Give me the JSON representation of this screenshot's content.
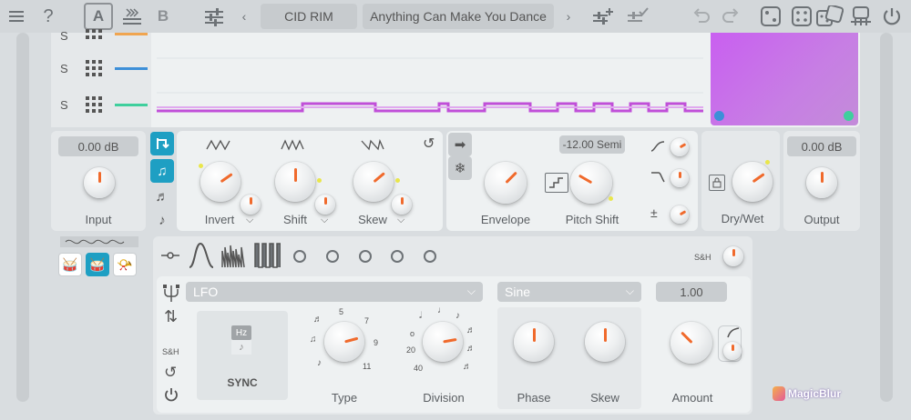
{
  "topbar": {
    "menu_icon": "hamburger-icon",
    "help_icon": "question-icon",
    "slot_a": "A",
    "slot_b": "B",
    "preset_category": "CID RIM",
    "preset_name": "Anything Can Make You Dance"
  },
  "sequencer": {
    "rows": [
      {
        "label": "S",
        "color": "#f0a550"
      },
      {
        "label": "S",
        "color": "#3d8fd8"
      },
      {
        "label": "S",
        "color": "#3fcf9d"
      }
    ],
    "pad_color": "#c060ea"
  },
  "input": {
    "value": "0.00 dB",
    "label": "Input"
  },
  "modulation_knobs": [
    {
      "label": "Invert",
      "indicator_deg": 235
    },
    {
      "label": "Shift",
      "indicator_deg": 180
    },
    {
      "label": "Skew",
      "indicator_deg": 230
    }
  ],
  "envelope": {
    "label": "Envelope",
    "indicator_deg": 225
  },
  "pitch_shift": {
    "value": "-12.00 Semi",
    "label": "Pitch Shift",
    "indicator_deg": 120
  },
  "drywet": {
    "label": "Dry/Wet"
  },
  "output": {
    "value": "0.00 dB",
    "label": "Output"
  },
  "lfo": {
    "sh_label": "S&H",
    "source": "LFO",
    "waveform": "Sine",
    "amount_value": "1.00",
    "sync_label": "SYNC",
    "hz_label": "Hz",
    "type_label": "Type",
    "division_label": "Division",
    "phase_label": "Phase",
    "skew_label": "Skew",
    "amount_label": "Amount",
    "type_ticks": [
      "5",
      "7",
      "9",
      "11"
    ],
    "division_ticks": [
      "o",
      "20",
      "40"
    ],
    "side_sh_label": "S&H"
  },
  "watermark": "MagicBlur"
}
